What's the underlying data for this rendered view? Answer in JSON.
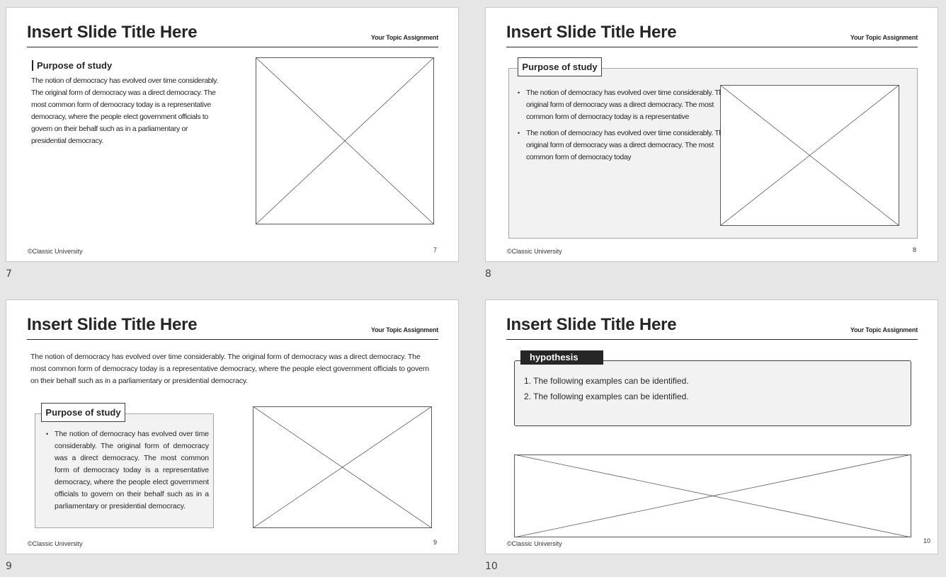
{
  "slides": [
    {
      "number": "7",
      "title": "Insert Slide Title Here",
      "topic": "Your Topic Assignment",
      "footer": "©Classic University",
      "page": "7",
      "heading": "Purpose of study",
      "text": "The notion of democracy has evolved over time considerably. The original form of democracy was a direct democracy. The most common form of democracy today is a representative democracy, where the people elect government officials to govern on their behalf such as in a parliamentary or presidential democracy."
    },
    {
      "number": "8",
      "title": "Insert Slide Title Here",
      "topic": "Your Topic Assignment",
      "footer": "©Classic University",
      "page": "8",
      "heading": "Purpose of study",
      "bullets": [
        "The notion of democracy has evolved over time considerably. The original form of democracy was a direct democracy. The most common form of democracy today is a representative",
        "The notion of democracy has evolved over time considerably. The original form of democracy was a direct democracy. The most common form of democracy today"
      ]
    },
    {
      "number": "9",
      "title": "Insert Slide Title Here",
      "topic": "Your Topic Assignment",
      "footer": "©Classic University",
      "page": "9",
      "intro": "The notion of democracy has evolved over time considerably. The original form of democracy was a direct democracy. The most common form of democracy today is a representative democracy, where the people elect government officials to govern on their behalf such as in a parliamentary or presidential democracy.",
      "heading": "Purpose of study",
      "bullets": [
        "The notion of democracy has evolved over time considerably. The original form of democracy was a direct democracy. The most common form of democracy today is a representative democracy, where the people elect government officials to govern on their behalf such as in a parliamentary or presidential democracy."
      ]
    },
    {
      "number": "10",
      "title": "Insert Slide Title Here",
      "topic": "Your Topic Assignment",
      "footer": "©Classic University",
      "page": "10",
      "tab_label": "hypothesis",
      "items": [
        "1.  The following examples can be identified.",
        "2.  The following examples can be identified."
      ]
    }
  ],
  "icons": {
    "placeholder": "image-placeholder-icon"
  },
  "colors": {
    "background": "#e6e6e6",
    "text": "#262626",
    "panel": "#f2f2f2",
    "tab": "#262626"
  }
}
